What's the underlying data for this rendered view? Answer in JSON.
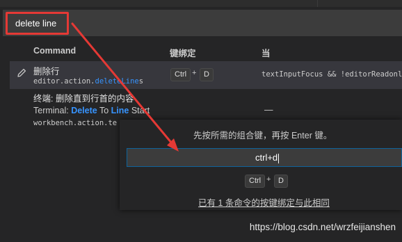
{
  "search": {
    "value": "delete line"
  },
  "columns": {
    "command": "Command",
    "keybinding": "键绑定",
    "when": "当"
  },
  "rows": [
    {
      "title": "删除行",
      "id_prefix": "editor.action.",
      "id_highlight": "deleteLine",
      "id_suffix": "s",
      "keys": [
        "Ctrl",
        "+",
        "D"
      ],
      "when": "textInputFocus && !editorReadonly"
    },
    {
      "title": "终端: 删除直到行首的内容",
      "alias_prefix": "Terminal: ",
      "alias_word1": "Delete",
      "alias_mid": " To ",
      "alias_word2": "Line",
      "alias_suffix": " Start",
      "id_prefix": "workbench.action.te",
      "keybinding": "—"
    }
  ],
  "dialog": {
    "prompt": "先按所需的组合键，再按 Enter 键。",
    "input_value": "ctrl+d",
    "keys": [
      "Ctrl",
      "+",
      "D"
    ],
    "conflict_link": "已有 1 条命令的按键绑定与此相同"
  },
  "watermark": "https://blog.csdn.net/wrzfeijianshen",
  "colors": {
    "annotation": "#e53935",
    "highlight": "#3794ff",
    "focus_border": "#0e639c"
  }
}
